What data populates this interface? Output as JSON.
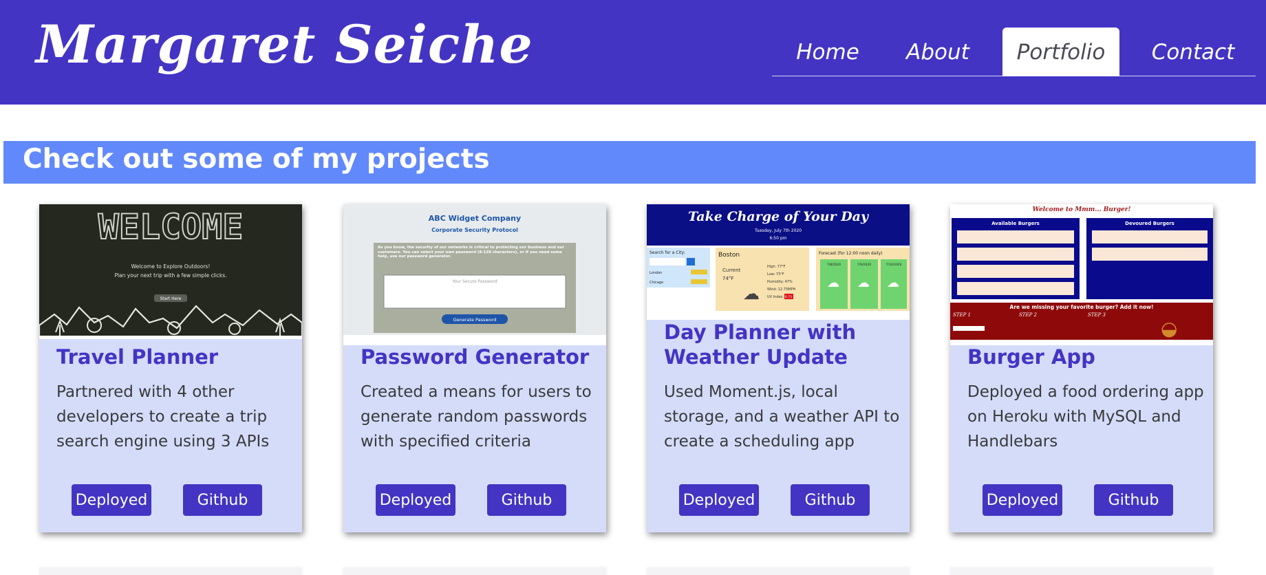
{
  "header": {
    "brand": "Margaret Seiche",
    "nav": [
      {
        "label": "Home",
        "active": false
      },
      {
        "label": "About",
        "active": false
      },
      {
        "label": "Portfolio",
        "active": true
      },
      {
        "label": "Contact",
        "active": false
      }
    ]
  },
  "colors": {
    "header_bg": "#4434c4",
    "banner_bg": "#6289fb",
    "card_bg": "#d4dcfa",
    "accent": "#4434c4"
  },
  "section": {
    "title": "Check out some of my projects"
  },
  "projects": [
    {
      "title": "Travel Planner",
      "description": "Partnered with 4 other developers to create a trip search engine using 3 APIs",
      "deployed_label": "Deployed",
      "github_label": "Github",
      "screenshot": {
        "heading": "WELCOME",
        "line1": "Welcome to Explore Outdoors!",
        "line2": "Plan your next trip with a few simple clicks.",
        "button": "Start Here"
      }
    },
    {
      "title": "Password Generator",
      "description": "Created a means for users to generate random passwords with specified criteria",
      "deployed_label": "Deployed",
      "github_label": "Github",
      "screenshot": {
        "company": "ABC Widget Company",
        "subtitle": "Corporate Security Protocol",
        "body": "As you know, the security of our networks is critical to protecting our business and our customers. You can select your own password (8-128 characters), or if you need some help, use our password generator.",
        "placeholder": "Your Secure Password",
        "button": "Generate Password"
      }
    },
    {
      "title": "Day Planner with Weather Update",
      "description": "Used Moment.js, local storage, and a weather API to create a scheduling app",
      "deployed_label": "Deployed",
      "github_label": "Github",
      "screenshot": {
        "heading": "Take Charge of Your Day",
        "date": "Tuesday, July 7th 2020",
        "time": "6:50 pm",
        "search_label": "Search for a City:",
        "cities": [
          "London",
          "Chicago"
        ],
        "city": "Boston",
        "current": "Current",
        "temp": "74°F",
        "stats": [
          "High: 77°F",
          "Low: 73°F",
          "Humidity: 47%",
          "Wind: 12.75MPH",
          "UV Index:"
        ],
        "uv": "6.73",
        "forecast_label": "Forecast (for 12:00 noon daily)",
        "forecast_dates": [
          "7/8/2020",
          "7/9/2020",
          "7/10/2020"
        ]
      }
    },
    {
      "title": "Burger App",
      "description": "Deployed a food ordering app on Heroku with MySQL and Handlebars",
      "deployed_label": "Deployed",
      "github_label": "Github",
      "screenshot": {
        "heading": "Welcome to Mmm... Burger!",
        "available": "Available Burgers",
        "devoured": "Devoured Burgers",
        "cta": "Are we missing your favorite burger? Add it now!",
        "steps": [
          "STEP 1",
          "STEP 2",
          "STEP 3"
        ]
      }
    }
  ]
}
